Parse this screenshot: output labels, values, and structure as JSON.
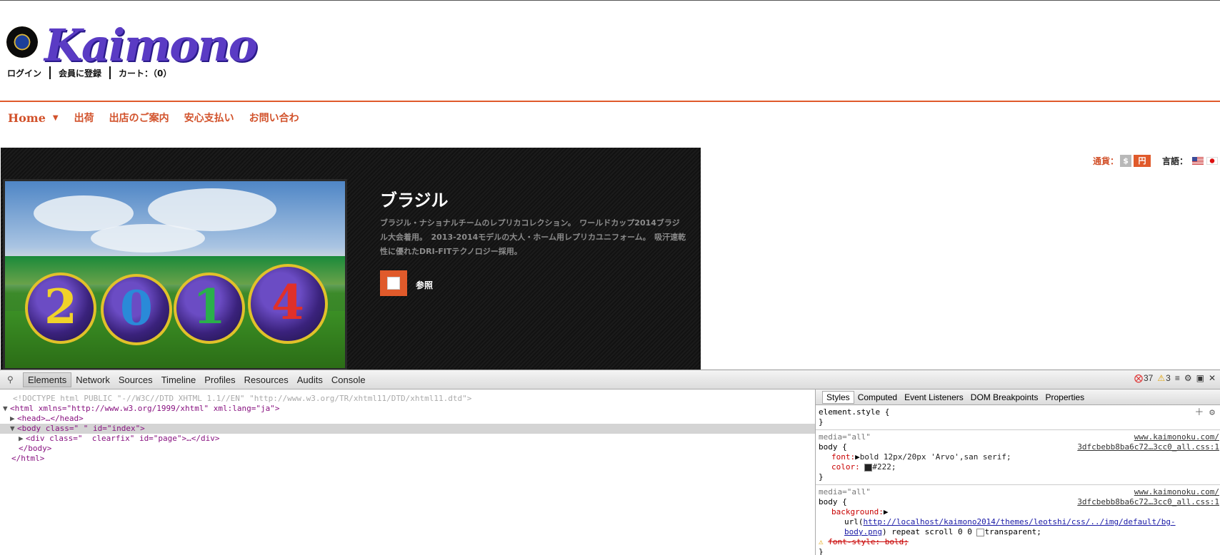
{
  "header": {
    "logo_text": "Kaimono",
    "toplinks": [
      "ログイン",
      "会員に登録",
      "カート：（0）"
    ]
  },
  "nav": {
    "items": [
      "Home",
      "出荷",
      "出店のご案内",
      "安心支払い",
      "お問い合わ"
    ]
  },
  "banner": {
    "title": "ブラジル",
    "description": "ブラジル・ナショナルチームのレプリカコレクション。　ワールドカップ2014ブラジル大会着用。　2013-2014モデルの大人・ホーム用レプリカユニフォーム。　吸汗速乾性に優れたDRI-FITテクノロジー採用。",
    "browse_label": "参照",
    "photo_digits": [
      "2",
      "0",
      "1",
      "4"
    ]
  },
  "currency": {
    "label": "通貨：",
    "dollar": "$",
    "yen": "円"
  },
  "language": {
    "label": "言語："
  },
  "devtools": {
    "tabs": [
      "Elements",
      "Network",
      "Sources",
      "Timeline",
      "Profiles",
      "Resources",
      "Audits",
      "Console"
    ],
    "errors": "37",
    "warnings": "3",
    "dom": [
      "<!DOCTYPE html PUBLIC \"-//W3C//DTD XHTML 1.1//EN\" \"http://www.w3.org/TR/xhtml11/DTD/xhtml11.dtd\">",
      "<html xmlns=\"http://www.w3.org/1999/xhtml\" xml:lang=\"ja\">",
      "<head>…</head>",
      "<body class=\" \" id=\"index\">",
      "<div class=\"  clearfix\" id=\"page\">…</div>",
      "</body>",
      "</html>"
    ],
    "style_tabs": [
      "Styles",
      "Computed",
      "Event Listeners",
      "DOM Breakpoints",
      "Properties"
    ],
    "rules": {
      "element_style": "element.style {",
      "close": "}",
      "media": "media=\"all\"",
      "src_site": "www.kaimonoku.com/",
      "src_file": "3dfcbebb8ba6c72…3cc0_all.css:1",
      "body_selector": "body {",
      "font_prop": "font:",
      "font_val": "bold 12px/20px 'Arvo',san serif;",
      "color_prop": "color:",
      "color_val": "#222;",
      "bg_prop": "background:",
      "bg_url": "http://localhost/kaimono2014/themes/leotshi/css/../img/default/bg-body.png",
      "bg_rest": ") repeat scroll 0 0",
      "bg_trans": "transparent;",
      "font_style": "font-style: bold;"
    }
  }
}
